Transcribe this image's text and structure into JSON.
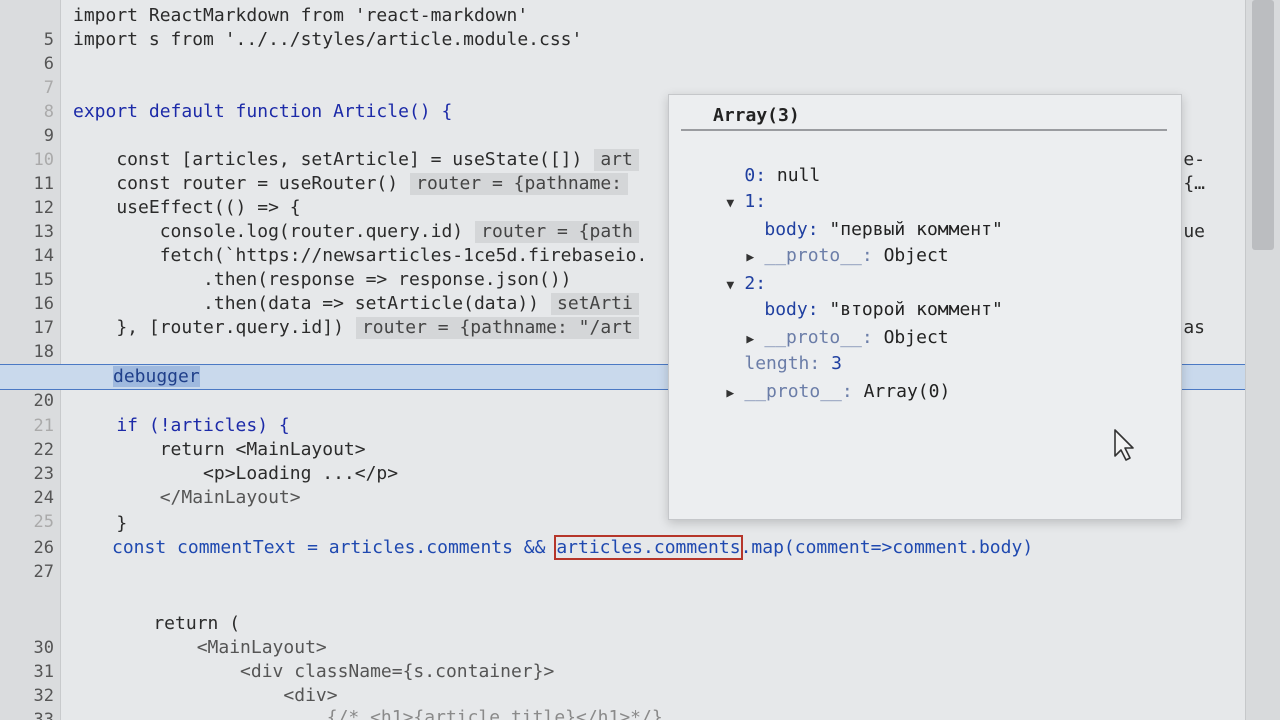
{
  "lines": [
    {
      "n": "5",
      "t": "import ReactMarkdown from 'react-markdown'"
    },
    {
      "n": "6",
      "t": "import s from '../../styles/article.module.css'"
    },
    {
      "n": "7",
      "t": ""
    },
    {
      "n": "8",
      "t": ""
    },
    {
      "n": "9",
      "t": "export default function Article() {"
    },
    {
      "n": "10",
      "t": ""
    },
    {
      "n": "11",
      "t": "    const [articles, setArticle] = useState([])",
      "inline": "art",
      "right": "-line-"
    },
    {
      "n": "12",
      "t": "    const router = useRouter()",
      "inline": "router = {pathname:",
      "right": "ery: {…"
    },
    {
      "n": "13",
      "t": "    useEffect(() => {"
    },
    {
      "n": "14",
      "t": "        console.log(router.query.id)",
      "inline": "router = {path",
      "right": "\", que"
    },
    {
      "n": "15",
      "t": "        fetch(`https://newsarticles-1ce5d.firebaseio."
    },
    {
      "n": "16",
      "t": "            .then(response => response.json())"
    },
    {
      "n": "17",
      "t": "            .then(data => setArticle(data))",
      "inline": "setArti"
    },
    {
      "n": "18",
      "t": "    }, [router.query.id])",
      "inline": "router = {pathname: \"/art",
      "right": "…}, as"
    },
    {
      "n": "19",
      "t": ""
    },
    {
      "n": "20",
      "t": "debugger"
    },
    {
      "n": "21",
      "t": ""
    },
    {
      "n": "22",
      "t": "    if (!articles) {"
    },
    {
      "n": "23",
      "t": "        return <MainLayout>"
    },
    {
      "n": "24",
      "t": "            <p>Loading ...</p>"
    },
    {
      "n": "25",
      "t": "        </MainLayout>"
    },
    {
      "n": "26",
      "t": "    }"
    },
    {
      "n": "27",
      "t": "const commentText = articles.comments && "
    },
    {
      "n": "28",
      "t": ""
    },
    {
      "n": "29",
      "t": ""
    },
    {
      "n": "30",
      "t": "    return ("
    },
    {
      "n": "31",
      "t": "        <MainLayout>"
    },
    {
      "n": "32",
      "t": "            <div className={s.container}>"
    },
    {
      "n": "33",
      "t": "                <div>"
    },
    {
      "n": "34",
      "t": "                    {/* <h1>{article.title}</h1>*/}"
    }
  ],
  "line27": {
    "prefix": "const commentText = articles.comments && ",
    "boxed": "articles.comments",
    "suffix": ".map(comment=>comment.body)"
  },
  "popup": {
    "title": "Array(3)",
    "rows": [
      {
        "arrow": "",
        "key": "0",
        "sep": ": ",
        "val": "null"
      },
      {
        "arrow": "▼",
        "key": "1",
        "sep": ":",
        "val": ""
      },
      {
        "arrow": "",
        "key": "body",
        "sep": ": ",
        "val": "\"первый коммент\""
      },
      {
        "arrow": "▶",
        "key": "__proto__",
        "sep": ": ",
        "val": "Object"
      },
      {
        "arrow": "▼",
        "key": "2",
        "sep": ":",
        "val": ""
      },
      {
        "arrow": "",
        "key": "body",
        "sep": ": ",
        "val": "\"второй коммент\""
      },
      {
        "arrow": "▶",
        "key": "__proto__",
        "sep": ": ",
        "val": "Object"
      },
      {
        "arrow": "",
        "key": "length",
        "sep": ": ",
        "val": "3"
      },
      {
        "arrow": "▶",
        "key": "__proto__",
        "sep": ": ",
        "val": "Array(0)"
      }
    ]
  },
  "icons": {
    "cursor": "mouse-pointer-icon",
    "expand": "triangle-right-icon",
    "collapse": "triangle-down-icon"
  }
}
